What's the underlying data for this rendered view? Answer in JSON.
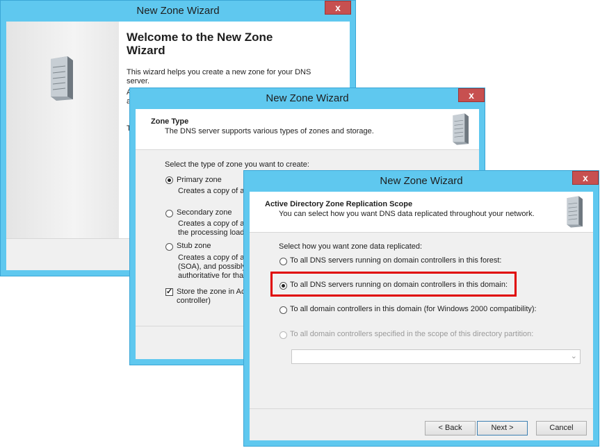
{
  "wizard1": {
    "title": "New Zone Wizard",
    "close": "x",
    "heading_line1": "Welcome to the New Zone",
    "heading_line2": "Wizard",
    "intro_line1": "This wizard helps you create a new zone for your DNS",
    "intro_line2": "server.",
    "partial_a1": "A",
    "partial_a2": "a",
    "partial_t": "T"
  },
  "wizard2": {
    "title": "New Zone Wizard",
    "close": "x",
    "header_title": "Zone Type",
    "header_sub": "The DNS server supports various types of zones and storage.",
    "prompt": "Select the type of zone you want to create:",
    "options": [
      {
        "label": "Primary zone",
        "desc1": "Creates a copy of a",
        "desc2": "",
        "desc3": "",
        "selected": true
      },
      {
        "label": "Secondary zone",
        "desc1": "Creates a copy of a",
        "desc2": "the processing load",
        "desc3": "",
        "selected": false
      },
      {
        "label": "Stub zone",
        "desc1": "Creates a copy of a",
        "desc2": "(SOA), and possibly",
        "desc3": "authoritative for tha",
        "selected": false
      }
    ],
    "store_label1": "Store the zone in Ac",
    "store_label2": "controller)",
    "store_checked": true
  },
  "wizard3": {
    "title": "New Zone Wizard",
    "close": "x",
    "header_title": "Active Directory Zone Replication Scope",
    "header_sub": "You can select how you want DNS data replicated throughout your network.",
    "prompt": "Select how you want zone data replicated:",
    "options": [
      {
        "label": "To all DNS servers running on domain controllers in this forest:",
        "selected": false,
        "enabled": true
      },
      {
        "label": "To all DNS servers running on domain controllers in this domain:",
        "selected": true,
        "enabled": true
      },
      {
        "label": "To all domain controllers in this domain (for Windows 2000 compatibility):",
        "selected": false,
        "enabled": true
      },
      {
        "label": "To all domain controllers specified in the scope of this directory partition:",
        "selected": false,
        "enabled": false
      }
    ],
    "partition_value": "",
    "buttons": {
      "back": "< Back",
      "next": "Next >",
      "cancel": "Cancel"
    }
  },
  "colors": {
    "accent": "#5fc8ef",
    "close": "#c75050",
    "highlight": "#e00000"
  }
}
